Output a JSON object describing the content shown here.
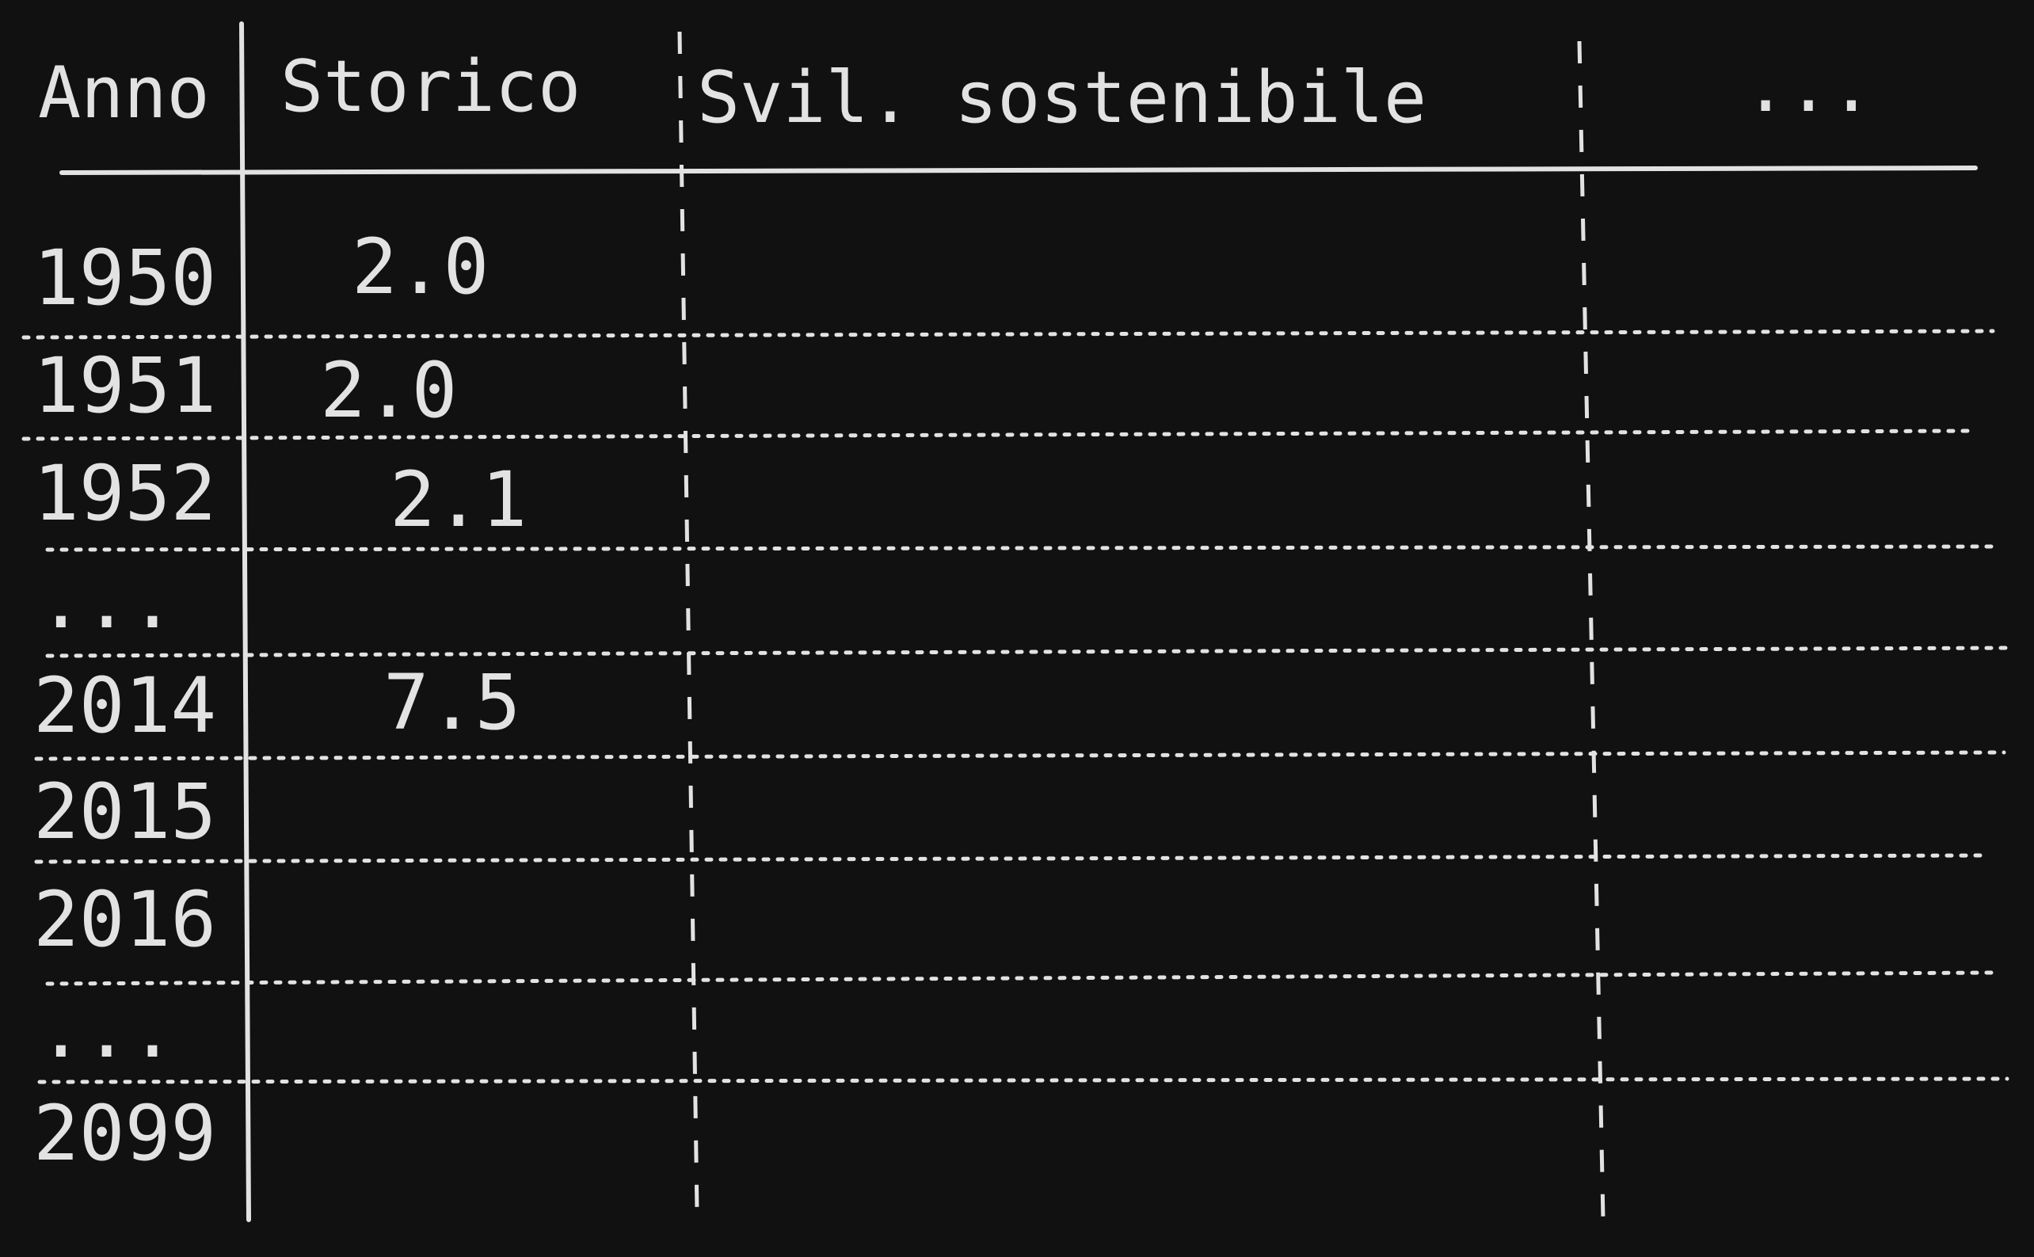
{
  "table": {
    "headers": {
      "year": "Anno",
      "historical": "Storico",
      "sustainable": "Svil. sostenibile",
      "more": "..."
    },
    "rows": [
      {
        "year": "1950",
        "historical": "2.0"
      },
      {
        "year": "1951",
        "historical": "2.0"
      },
      {
        "year": "1952",
        "historical": "2.1"
      },
      {
        "year": "...",
        "historical": ""
      },
      {
        "year": "2014",
        "historical": "7.5"
      },
      {
        "year": "2015",
        "historical": ""
      },
      {
        "year": "2016",
        "historical": ""
      },
      {
        "year": "...",
        "historical": ""
      },
      {
        "year": "2099",
        "historical": ""
      }
    ]
  },
  "colors": {
    "background": "#111111",
    "ink": "#e2e2e2"
  }
}
